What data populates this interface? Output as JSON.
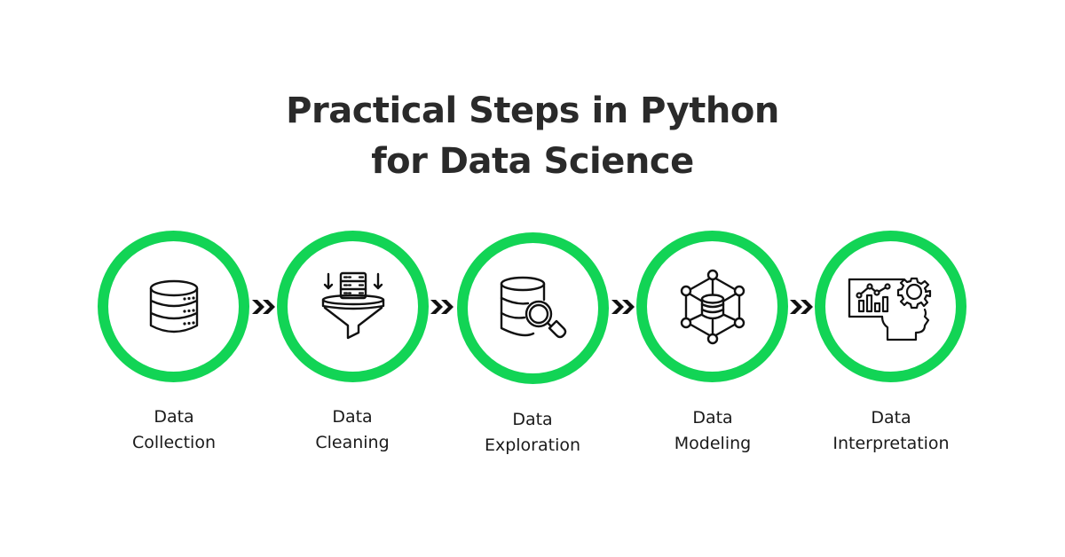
{
  "title": {
    "line1": "Practical Steps in Python",
    "line2": "for Data Science"
  },
  "accent_color": "#12D455",
  "steps": [
    {
      "line1": "Data",
      "line2": "Collection",
      "icon": "database-icon"
    },
    {
      "line1": "Data",
      "line2": "Cleaning",
      "icon": "data-filter-funnel-icon"
    },
    {
      "line1": "Data",
      "line2": "Exploration",
      "icon": "database-search-icon"
    },
    {
      "line1": "Data",
      "line2": "Modeling",
      "icon": "data-network-model-icon"
    },
    {
      "line1": "Data",
      "line2": "Interpretation",
      "icon": "analytics-mind-icon"
    }
  ],
  "connector_icon": "double-chevron-right-icon"
}
